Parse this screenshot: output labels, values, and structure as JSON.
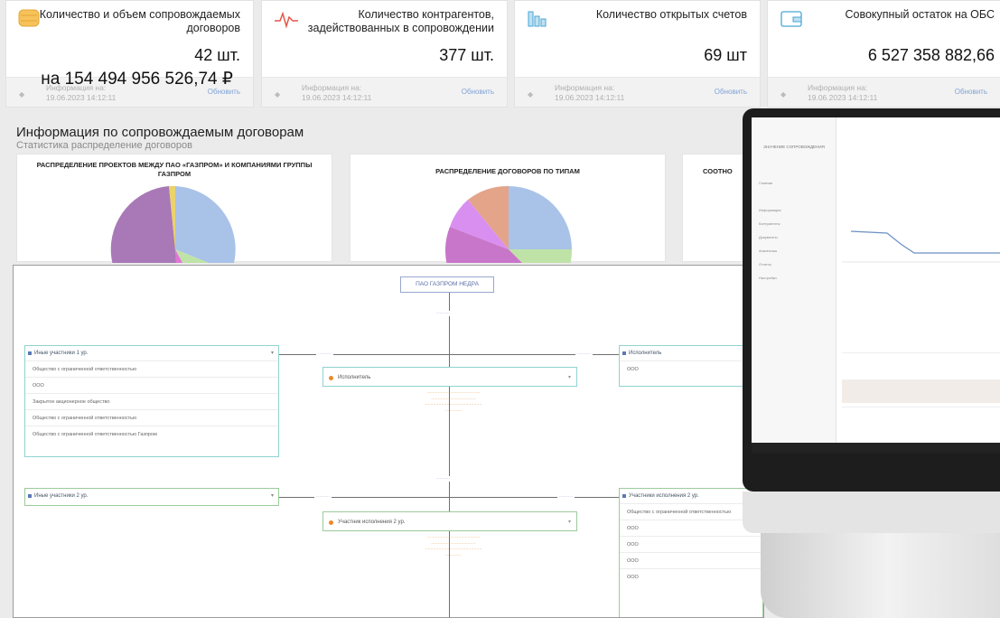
{
  "kpis": [
    {
      "title": "Количество и объем сопровождаемых договоров",
      "value": "42 шт.",
      "value2": "на 154 494 956 526,74 ₽",
      "info_label": "Информация на:",
      "info_date": "19.06.2023 14:12:11",
      "update": "Обновить",
      "icon": "database-icon",
      "color": "#f0b43c"
    },
    {
      "title": "Количество контрагентов, задействованных в сопровождении",
      "value": "377 шт.",
      "info_label": "Информация на:",
      "info_date": "19.06.2023 14:12:11",
      "update": "Обновить",
      "icon": "pulse-icon",
      "color": "#e4574a"
    },
    {
      "title": "Количество открытых счетов",
      "value": "69 шт",
      "info_label": "Информация на:",
      "info_date": "19.06.2023 14:12:11",
      "update": "Обновить",
      "icon": "bank-icon",
      "color": "#4aa6d6"
    },
    {
      "title": "Совокупный остаток на ОБС",
      "value": "6 527 358 882,66",
      "info_label": "Информация на:",
      "info_date": "19.06.2023 14:12:11",
      "update": "Обновить",
      "icon": "wallet-icon",
      "color": "#4aa6d6"
    }
  ],
  "section": {
    "title": "Информация по сопровождаемым договорам",
    "subtitle": "Статистика распределение договоров"
  },
  "charts": [
    {
      "title": "РАСПРЕДЕЛЕНИЕ ПРОЕКТОВ МЕЖДУ ПАО «ГАЗПРОМ» И КОМПАНИЯМИ ГРУППЫ ГАЗПРОМ",
      "type": "pie"
    },
    {
      "title": "РАСПРЕДЕЛЕНИЕ ДОГОВОРОВ ПО ТИПАМ",
      "type": "pie"
    },
    {
      "title": "СООТНО",
      "type": "pie"
    }
  ],
  "org": {
    "top_node": "ПАО ГАЗПРОМ НЕДРА",
    "executor": "Исполнитель",
    "participant": "Участник исполнения 2 ур.",
    "left_box_1": {
      "header": "Иные участники 1 ур.",
      "rows": [
        "Общество с ограниченной ответственностью",
        "ООО",
        "Закрытое акционерное общество",
        "Общество с ограниченной ответственностью",
        "Общество с ограниченной ответственностью Газпром"
      ]
    },
    "right_box_1": {
      "header": "Исполнитель",
      "rows": [
        "ООО"
      ]
    },
    "left_box_2": {
      "header": "Иные участники 2 ур."
    },
    "right_box_2": {
      "header": "Участники исполнения 2 ур.",
      "rows": [
        "Общество с ограниченной ответственностью",
        "ООО",
        "ООО",
        "ООО",
        "ООО"
      ]
    }
  },
  "monitor": {
    "side_title": "ЗНАЧЕНИЕ СОПРОВОЖДЕНИЯ",
    "side_items": [
      "Главная",
      "Информация",
      "Контрагенты",
      "Документы",
      "Аналитика",
      "Отчеты",
      "Настройки"
    ]
  }
}
